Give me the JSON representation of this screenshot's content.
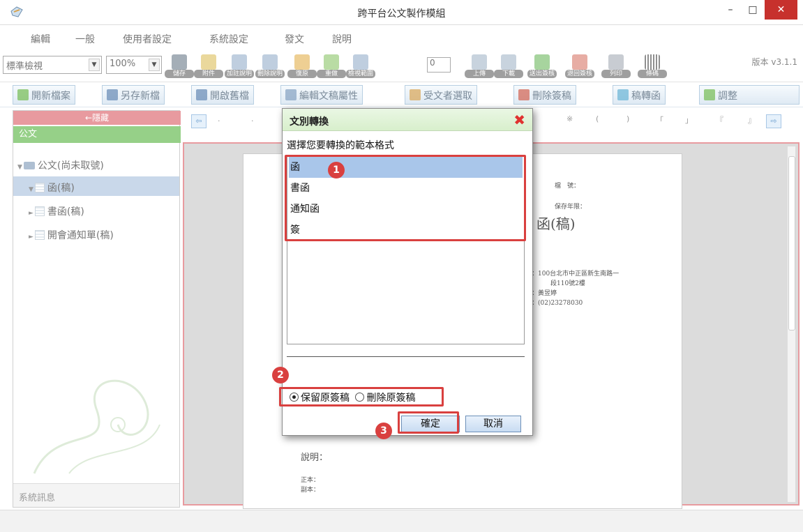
{
  "window": {
    "title": "跨平台公文製作模組",
    "minimize": "–",
    "maximize": "□",
    "close": "✕"
  },
  "menu": [
    "編輯",
    "一般",
    "使用者設定",
    "系統設定",
    "發文",
    "說明"
  ],
  "toolbar1": {
    "view_mode": "標準檢視",
    "zoom": "100%",
    "buttons": [
      "儲存",
      "附件",
      "加註說明",
      "刪除說明",
      "復原",
      "重做",
      "檢視範圍",
      "上傳",
      "下載",
      "送出簽核",
      "退回簽核",
      "列印",
      "條碼"
    ],
    "spinner_value": "0",
    "version": "版本 v3.1.1"
  },
  "toolbar2": [
    "開新檔案",
    "另存新檔",
    "開啟舊檔",
    "編輯文稿屬性",
    "受文者選取",
    "刪除簽稿",
    "稿轉函",
    "調整"
  ],
  "left_panel": {
    "collapse_label": "←隱藏",
    "section": "公文",
    "tree": [
      {
        "label": "公文(尚未取號)"
      },
      {
        "label": "函(稿)"
      },
      {
        "label": "書函(稿)"
      },
      {
        "label": "開會通知單(稿)"
      }
    ],
    "system_message": "系統訊息"
  },
  "nav": {
    "prev": "⇦",
    "next": "⇨",
    "marks": [
      ".",
      ".",
      "※",
      "(",
      ")",
      "「",
      "」",
      "『",
      "』"
    ]
  },
  "page": {
    "file_no_label": "檔　號：",
    "retention_label": "保存年限：",
    "doc_title": "函(稿)",
    "address_1": "址：100台北市中正區新生南路一",
    "address_2": "段110號2樓",
    "contact": "人：黃昱婷",
    "phone": "話：(02)23278030",
    "explain": "說明：",
    "main_copy": "正本：",
    "copy": "副本："
  },
  "dialog": {
    "title": "文別轉換",
    "close": "✖",
    "prompt": "選擇您要轉換的範本格式",
    "options": [
      "函",
      "書函",
      "通知函",
      "簽"
    ],
    "selected_index": 0,
    "radio_keep": "保留原簽稿",
    "radio_delete": "刪除原簽稿",
    "radio_selected": "keep",
    "ok": "確定",
    "cancel": "取消"
  },
  "annotations": {
    "step1": "1",
    "step2": "2",
    "step3": "3",
    "highlight_color": "#d9403f"
  }
}
